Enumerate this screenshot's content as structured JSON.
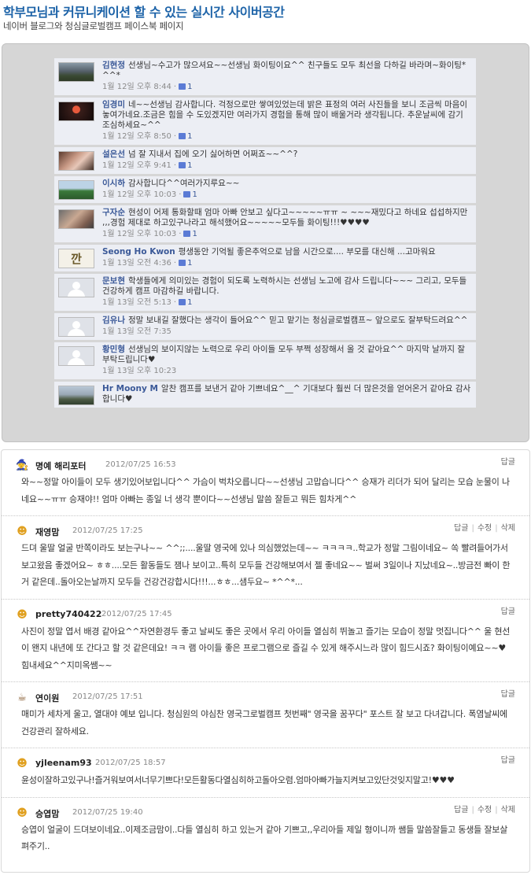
{
  "header": {
    "title": "학부모님과 커뮤니케이션 할 수 있는 실시간 사이버공간",
    "subtitle": "네이버 블로그와 청심글로벌캠프 페이스북 페이지"
  },
  "facebook": {
    "comments": [
      {
        "author": "김현정",
        "text": "선생님~수고가 많으셔요~~선생님 화이팅이요^^ 친구들도 모두 최선을 다하길 바라며~화이팅*^^*",
        "time": "1월 12일 오후 8:44",
        "likes": "1",
        "avatar": "landscape-photo"
      },
      {
        "author": "임경미",
        "text": "네~~선생님 감사합니다. 걱정으로만 쌓여있었는데 밝은 표정의 여러 사진들을 보니 조금씩 마음이 놓여가네요.조금은 힘을 수 도있겠지만 여러가지 경험을 통해 많이 배울거라 생각됩니다. 추운날씨에 감기 조심하세요~^^",
        "time": "1월 12일 오후 8:50",
        "likes": "1",
        "avatar": "lantern-photo"
      },
      {
        "author": "설은선",
        "text": "넘 잘 지내서 집에 오기 싫어하면 어쩌죠~~^^?",
        "time": "1월 12일 오후 9:41",
        "likes": "1",
        "avatar": "girl-photo"
      },
      {
        "author": "이시하",
        "text": "감사합니다^^여러가지루요~~",
        "time": "1월 12일 오후 10:03",
        "likes": "1",
        "avatar": "field-photo"
      },
      {
        "author": "구자순",
        "text": "현성이 어제 통화할때 엄마 아빠 안보고 싶다고~~~~~ㅠㅠ ~ ~~~재밌다고 하네요 섭섭하지만 ,,,경험 제대로 하고있구나라고 해석했어요~~~~~모두들 화이팅!!!♥♥♥♥",
        "time": "1월 12일 오후 10:03",
        "likes": "1",
        "avatar": "person-photo"
      },
      {
        "author": "Seong Ho Kwon",
        "text": "평생동안 기억될 좋은추억으로 남을 시간으로.... 부모를 대신해 ...고마워요",
        "time": "1월 13일 오전 4:36",
        "likes": "1",
        "avatar": "logo"
      },
      {
        "author": "문보현",
        "text": "학생들에게 의미있는 경험이 되도록 노력하시는 선생님 노고에 감사 드립니다~~~ 그리고, 모두들 건강하게 캠프 마감하길 바랍니다.",
        "time": "1월 13일 오전 5:13",
        "likes": "1",
        "avatar": "default-profile"
      },
      {
        "author": "김유나",
        "text": "정말 보내길 잘했다는 생각이 들어요^^ 믿고 맡기는 청심글로벌캠프~ 앞으로도 잘부탁드려요^^",
        "time": "1월 13일 오전 7:35",
        "likes": "",
        "avatar": "default-profile"
      },
      {
        "author": "황민형",
        "text": "선생님의 보이지않는 노력으로 우리 아이들 모두 부쩍 성장해서 올 것 같아요^^ 마지막 날까지 잘 부탁드립니다♥",
        "time": "1월 13일 오후 10:23",
        "likes": "",
        "avatar": "default-profile"
      },
      {
        "author": "Hr Moony M",
        "text": "알찬 캠프를 보낸거 같아 기쁘네요^__^ 기대보다 훨씬 더 많은것을 얻어온거 같아요 감사합니다♥",
        "time": "",
        "likes": "",
        "avatar": "group-photo"
      }
    ]
  },
  "blog": {
    "reply_label": "답글",
    "edit_label": "수정",
    "delete_label": "삭제",
    "comments": [
      {
        "author": "명예 해리포터",
        "date": "2012/07/25 16:53",
        "icon": "wizard-icon",
        "owner": false,
        "text": "와~~정말 아이들이 모두 생기있어보입니다^^ 가슴이 벅차오릅니다~~선생님 고맙습니다^^ 승재가 리더가 되어 달리는 모습 눈물이 나네요~~ㅠㅠ 승재야!! 엄마 아빠는 종일 너 생각 뿐이다~~선생님 말씀 잘듣고 뭐든 힘차게^^"
      },
      {
        "author": "재영맘",
        "date": "2012/07/25 17:25",
        "icon": "smiley-icon",
        "owner": true,
        "text": "드뎌 울딸 얼굴 반쪽이라도 보는구나~~ ^^;;....울딸 영국에 있나 의심했었는데~~ ㅋㅋㅋㅋ..학교가 정말 그림이네요~ 쏙 빨려들어가서 보고왔음 좋겠어요~ ㅎㅎ....모든 활동들도 잼나 보이고..특히 모두들 건강해보여서 젤 좋네요~~ 벌써 3일이나 지났네요~..방금전 빠이 한거 같은데..돌아오는날까지 모두들 건강건강합시다!!!...ㅎㅎ...샘두요~ *^^*..."
      },
      {
        "author": "pretty740422",
        "date": "2012/07/25 17:45",
        "icon": "smiley-icon",
        "owner": false,
        "text": "사진이 정말 엽서 배경 같아요^^자연환경두 좋고 날씨도 좋은 곳에서 우리 아이들 열심히 뛰놀고 즐기는 모습이 정말 멋집니다^^ 울 현선이 왠지 내년에 또 간다고 할 것 같은데요! ㅋㅋ 램 아이들 좋은 프로그램으로 즐길 수 있게 해주시느라 많이 힘드시죠? 화이팅이예요~~♥힘내세요^^지미옥쌤~~"
      },
      {
        "author": "연이원",
        "date": "2012/07/25 17:51",
        "icon": "coffee-icon",
        "owner": false,
        "text": "매미가 세차게 울고, 열대야 예보 입니다. 청심원의 야심찬 영국그로벌캠프 첫번째\" 영국을 꿈꾸다\" 포스트 잘 보고 다녀갑니다. 폭염날씨에 건강관리 잘하세요."
      },
      {
        "author": "yjleenam93",
        "date": "2012/07/25 18:57",
        "icon": "smiley-icon",
        "owner": false,
        "text": "윤성이잘하고있구나!즐거워보여서너무기쁘다!모든활동다열심히하고돌아오렴.엄마아빠가늘지켜보고있단것잊지말고!♥♥♥"
      },
      {
        "author": "승엽맘",
        "date": "2012/07/25 19:40",
        "icon": "smiley-icon",
        "owner": true,
        "text": "승엽이 얼굴이 드뎌보이네요..이제조금맘이..다들 열심히 하고 있는거 같아 기쁘고,,우리아들 제일 형이니까 쌤들 말씀잘들고 동생들 잘보살펴주기.."
      }
    ]
  }
}
